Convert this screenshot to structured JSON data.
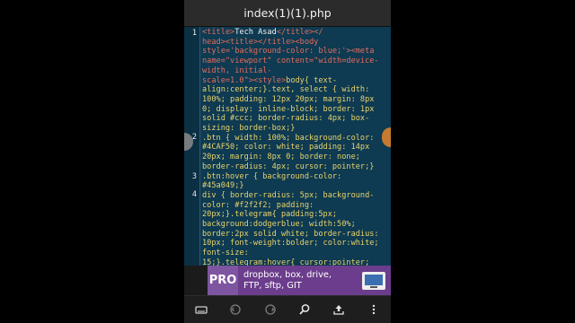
{
  "window": {
    "title": "index(1)(1).php"
  },
  "editor": {
    "line_numbers": [
      "1",
      "2",
      "3",
      "4"
    ],
    "code": {
      "l1_a": "<title>",
      "l1_b": "Tech Asad",
      "l1_c": "</title></",
      "l1_d": "head><title></title><body",
      "l1_e": "style='background-color: blue;'><meta",
      "l1_f": "name=\"viewport\" content=\"width=device-",
      "l1_g": "width, initial-",
      "l1_h": "scale=1.0\"><style>",
      "l1_i": "body{ text-",
      "l1_j": "align:center;}.text, select { width:",
      "l1_k": "100%; padding: 12px 20px; margin: 8px",
      "l1_l": "0; display: inline-block; border: 1px",
      "l1_m": "solid #ccc; border-radius: 4px; box-",
      "l1_n": "sizing: border-box;}",
      "l2_a": ".btn { width: 100%; background-color:",
      "l2_b": "#4CAF50; color: white; padding: 14px",
      "l2_c": "20px; margin: 8px 0; border: none;",
      "l2_d": "border-radius: 4px; cursor: pointer;}",
      "l3_a": ".btn:hover { background-color:",
      "l3_b": "#45a049;}",
      "l4_a": "div { border-radius: 5px; background-",
      "l4_b": "color: #f2f2f2; padding:",
      "l4_c": "20px;}.telegram{ padding:5px;",
      "l4_d": "background:dodgerblue; width:50%;",
      "l4_e": "border:2px solid white; border-radius:",
      "l4_f": "10px; font-weight:bolder; color:white;",
      "l4_g": "font-size:",
      "l4_h": "15;}.telegram:hover{ cursor:pointer;"
    }
  },
  "ad": {
    "badge": "PRO",
    "line1": "dropbox, box, drive,",
    "line2": "FTP, sftp, GIT",
    "icon": "monitor-icon"
  },
  "toolbar": {
    "icons": [
      "keyboard-icon",
      "undo-icon",
      "redo-icon",
      "search-icon",
      "upload-icon",
      "more-vert-icon"
    ]
  },
  "colors": {
    "editor_bg": "#0e3a52",
    "tag": "#e56c5a",
    "css": "#e9d36a",
    "text": "#f2f2f2",
    "ad_bg": "#6b3d8c"
  }
}
